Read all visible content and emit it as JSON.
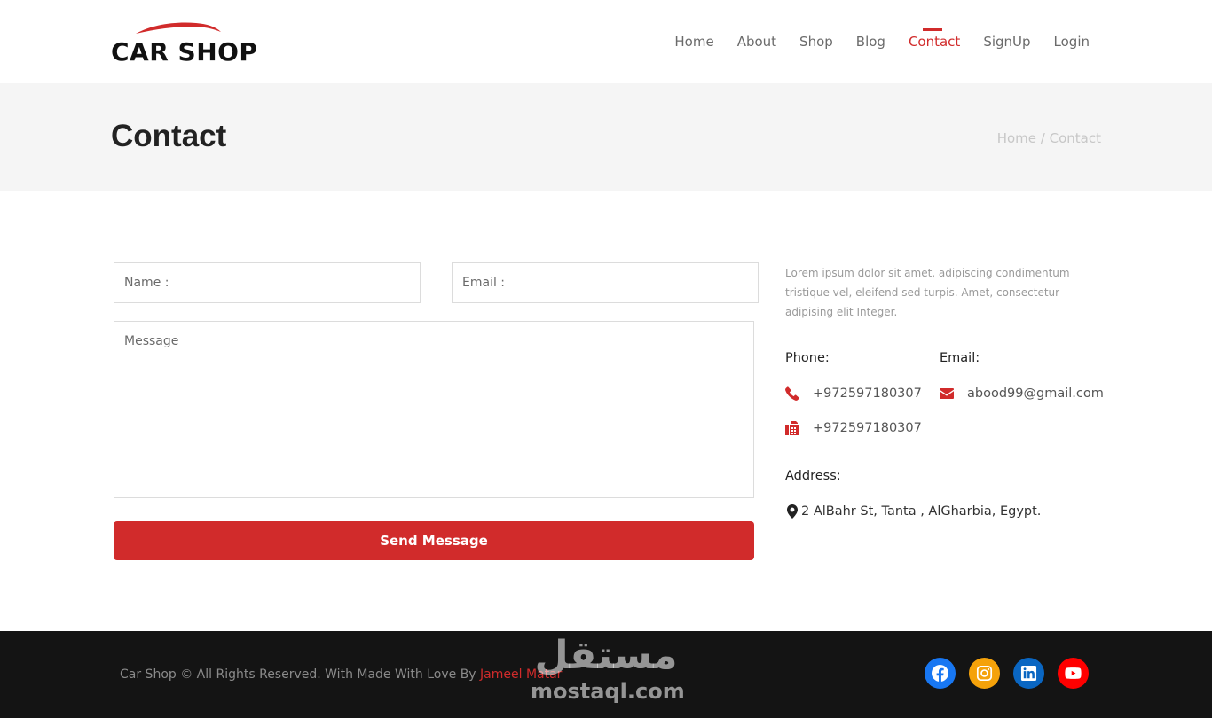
{
  "header": {
    "logo_text": "CAR SHOP",
    "nav": [
      {
        "label": "Home"
      },
      {
        "label": "About"
      },
      {
        "label": "Shop"
      },
      {
        "label": "Blog"
      },
      {
        "label": "Contact",
        "active": true
      },
      {
        "label": "SignUp"
      },
      {
        "label": "Login"
      }
    ]
  },
  "banner": {
    "title": "Contact",
    "breadcrumb": {
      "home": "Home",
      "separator": "/",
      "current": "Contact"
    }
  },
  "form": {
    "name_placeholder": "Name :",
    "email_placeholder": "Email :",
    "message_placeholder": "Message",
    "submit_label": "Send Message"
  },
  "contact_info": {
    "description": "Lorem ipsum dolor sit amet, adipiscing condimentum tristique vel, eleifend sed turpis. Amet, consectetur adipising elit Integer.",
    "phone_label": "Phone:",
    "phone": "+972597180307",
    "fax": "+972597180307",
    "email_label": "Email:",
    "email": "abood99@gmail.com",
    "address_label": "Address:",
    "address": "2 AlBahr St, Tanta , AlGharbia, Egypt."
  },
  "footer": {
    "copyright": "Car Shop © All Rights Reserved. With Made With Love By",
    "author": "Jameel Matar",
    "socials": [
      {
        "icon": "facebook-icon",
        "color": "#1877f2"
      },
      {
        "icon": "instagram-icon",
        "color": "#f5a20a"
      },
      {
        "icon": "linkedin-icon",
        "color": "#0a66c2"
      },
      {
        "icon": "youtube-icon",
        "color": "#ff0000"
      }
    ]
  },
  "watermark": {
    "arabic": "مستقل",
    "latin": "mostaql.com"
  },
  "colors": {
    "accent": "#d12b2b",
    "footer_bg": "#141414",
    "banner_bg": "#f5f5f5"
  }
}
